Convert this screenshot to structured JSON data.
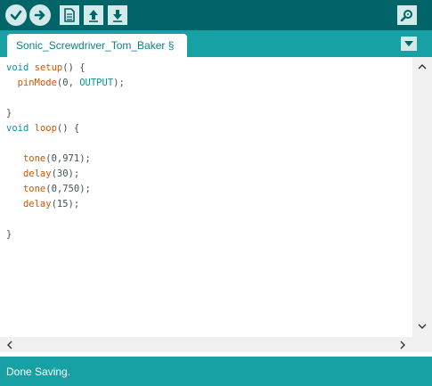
{
  "toolbar": {
    "buttons": [
      {
        "name": "verify",
        "icon": "checkmark-icon"
      },
      {
        "name": "upload",
        "icon": "arrow-right-icon"
      },
      {
        "name": "new",
        "icon": "new-file-icon"
      },
      {
        "name": "open",
        "icon": "arrow-up-icon"
      },
      {
        "name": "save",
        "icon": "arrow-down-icon"
      },
      {
        "name": "serial-monitor",
        "icon": "magnifier-icon"
      }
    ]
  },
  "tabs": [
    {
      "label": "Sonic_Screwdriver_Tom_Baker §"
    }
  ],
  "editor": {
    "code_lines": [
      "void setup() {",
      "  pinMode(0, OUTPUT);",
      "",
      "}",
      "void loop() {",
      "",
      "   tone(0,971);",
      "   delay(30);",
      "   tone(0,750);",
      "   delay(15);",
      "",
      "}"
    ]
  },
  "status": {
    "message": "Done Saving."
  },
  "colors": {
    "toolbar_bg": "#006468",
    "tabbar_bg": "#17a1a5",
    "keyword": "#00979c",
    "function": "#d35400",
    "status_bg": "#17a1a5"
  }
}
